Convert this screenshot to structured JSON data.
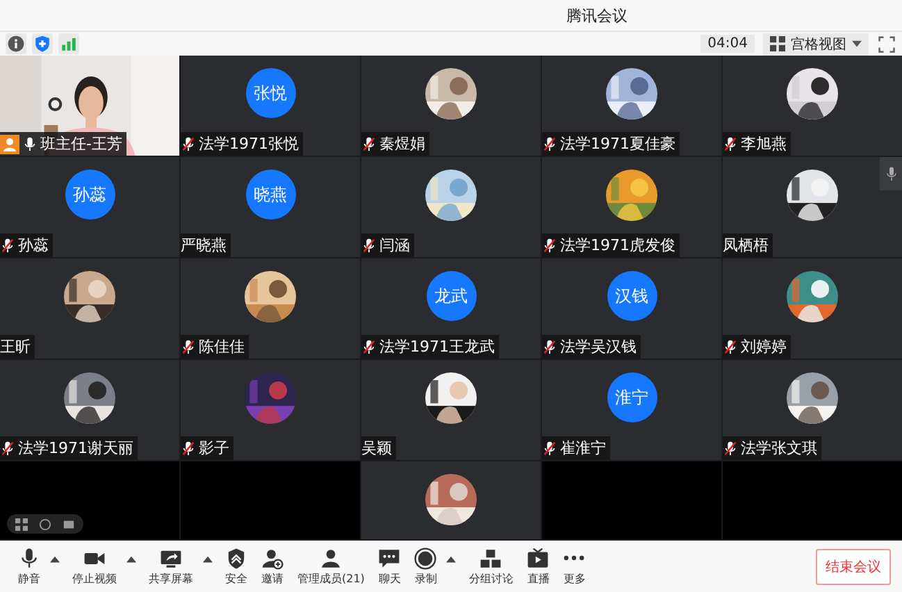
{
  "window": {
    "title": "腾讯会议"
  },
  "info_bar": {
    "timer": "04:04",
    "view_label": "宫格视图"
  },
  "participants": [
    {
      "name": "班主任-王芳",
      "kind": "video",
      "muted": false,
      "host": true
    },
    {
      "name": "法学1971张悦",
      "kind": "initials",
      "initials": "张悦",
      "muted": true
    },
    {
      "name": "秦煜娟",
      "kind": "picture",
      "muted": true
    },
    {
      "name": "法学1971夏佳豪",
      "kind": "picture",
      "muted": true
    },
    {
      "name": "李旭燕",
      "kind": "picture",
      "muted": true
    },
    {
      "name": "孙蕊",
      "kind": "initials",
      "initials": "孙蕊",
      "muted": true
    },
    {
      "name": "严晓燕",
      "kind": "initials",
      "initials": "晓燕",
      "muted": false
    },
    {
      "name": "闫涵",
      "kind": "picture",
      "muted": true
    },
    {
      "name": "法学1971虎发俊",
      "kind": "picture",
      "muted": true
    },
    {
      "name": "凤栖梧",
      "kind": "picture",
      "muted": false
    },
    {
      "name": "王昕",
      "kind": "picture",
      "muted": false
    },
    {
      "name": "陈佳佳",
      "kind": "picture",
      "muted": true
    },
    {
      "name": "法学1971王龙武",
      "kind": "initials",
      "initials": "龙武",
      "muted": true
    },
    {
      "name": "法学吴汉钱",
      "kind": "initials",
      "initials": "汉钱",
      "muted": true
    },
    {
      "name": "刘婷婷",
      "kind": "picture",
      "muted": true
    },
    {
      "name": "法学1971谢天丽",
      "kind": "picture",
      "muted": true
    },
    {
      "name": "影子",
      "kind": "picture",
      "muted": true
    },
    {
      "name": "吴颖",
      "kind": "picture",
      "muted": false
    },
    {
      "name": "崔淮宁",
      "kind": "initials",
      "initials": "淮宁",
      "muted": true
    },
    {
      "name": "法学张文琪",
      "kind": "picture",
      "muted": true
    },
    {
      "kind": "empty"
    },
    {
      "kind": "empty"
    },
    {
      "kind": "picture"
    },
    {
      "kind": "empty"
    },
    {
      "kind": "empty"
    }
  ],
  "toolbar": [
    {
      "label": "静音",
      "kind": "mic",
      "caret": true
    },
    {
      "label": "停止视频",
      "kind": "camera",
      "caret": true
    },
    {
      "label": "共享屏幕",
      "kind": "share",
      "caret": true
    },
    {
      "label": "安全",
      "kind": "shield",
      "caret": false
    },
    {
      "label": "邀请",
      "kind": "invite",
      "caret": false
    },
    {
      "label": "管理成员(21)",
      "kind": "members",
      "caret": false
    },
    {
      "label": "聊天",
      "kind": "chat",
      "caret": false
    },
    {
      "label": "录制",
      "kind": "record",
      "caret": true
    },
    {
      "label": "分组讨论",
      "kind": "groups",
      "caret": false
    },
    {
      "label": "直播",
      "kind": "live",
      "caret": false
    },
    {
      "label": "更多",
      "kind": "more",
      "caret": false
    }
  ],
  "end_button": "结束会议"
}
